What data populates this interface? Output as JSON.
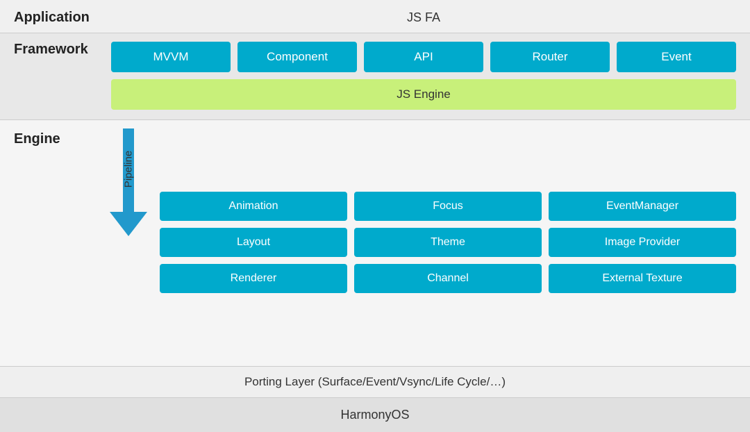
{
  "application": {
    "label": "Application",
    "content": "JS FA"
  },
  "framework": {
    "label": "Framework",
    "boxes": [
      "MVVM",
      "Component",
      "API",
      "Router",
      "Event"
    ],
    "engine": "JS Engine"
  },
  "engine": {
    "label": "Engine",
    "pipeline": "Pipeline",
    "rows": [
      [
        "Animation",
        "Focus",
        "EventManager"
      ],
      [
        "Layout",
        "Theme",
        "Image Provider"
      ],
      [
        "Renderer",
        "Channel",
        "External Texture"
      ]
    ]
  },
  "porting": {
    "label": "Porting Layer (Surface/Event/Vsync/Life Cycle/…)"
  },
  "harmonyos": {
    "label": "HarmonyOS"
  }
}
